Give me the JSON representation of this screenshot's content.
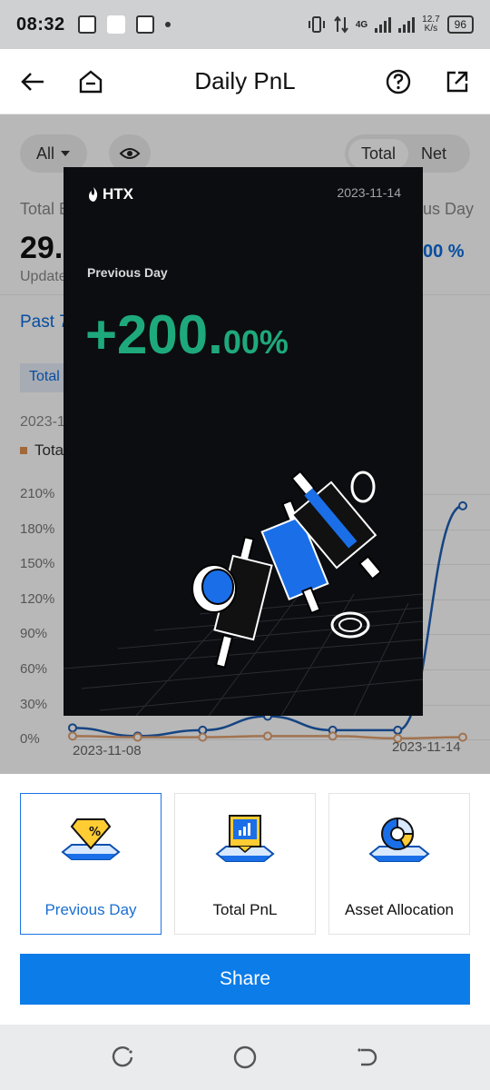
{
  "status_bar": {
    "time": "08:32",
    "network": "4G",
    "speed_value": "12.7",
    "speed_unit": "K/s",
    "battery": "96"
  },
  "header": {
    "title": "Daily PnL",
    "icons": [
      "back-arrow-icon",
      "home-icon",
      "help-icon",
      "share-out-icon"
    ]
  },
  "background": {
    "filter": "All",
    "toggle_total": "Total",
    "toggle_net": "Net",
    "total_label_partial": "Total B",
    "balance_partial": "29.",
    "updated_partial": "Update",
    "prev_day_partial": "us Day",
    "prev_day_value_partial": "00 %",
    "tab_partial": "Past 7",
    "chip_partial": "Total",
    "date_partial": "2023-1",
    "legend_partial": "Tota",
    "y_ticks": [
      "210%",
      "180%",
      "150%",
      "120%",
      "90%",
      "60%",
      "30%",
      "0%"
    ],
    "x_start": "2023-11-08",
    "x_end": "2023-11-14"
  },
  "chart_data": {
    "type": "line",
    "x": [
      "2023-11-08",
      "2023-11-09",
      "2023-11-10",
      "2023-11-11",
      "2023-11-12",
      "2023-11-13",
      "2023-11-14"
    ],
    "series": [
      {
        "values": [
          10,
          3,
          8,
          20,
          8,
          8,
          200
        ]
      },
      {
        "values": [
          3,
          2,
          2,
          3,
          3,
          1,
          2
        ]
      }
    ],
    "ylim": [
      0,
      210
    ],
    "colors": [
      "#1f5fb5",
      "#e0a070"
    ]
  },
  "card": {
    "logo": "HTX",
    "date": "2023-11-14",
    "label": "Previous Day",
    "value_main": "+200.",
    "value_decimal": "00%",
    "value_color": "#1ea97c"
  },
  "options": [
    {
      "label": "Previous Day",
      "icon": "percent-badge-icon",
      "selected": true
    },
    {
      "label": "Total PnL",
      "icon": "bar-chart-icon",
      "selected": false
    },
    {
      "label": "Asset Allocation",
      "icon": "pie-chart-icon",
      "selected": false
    }
  ],
  "share_button": "Share",
  "accent": "#0c7ce8"
}
